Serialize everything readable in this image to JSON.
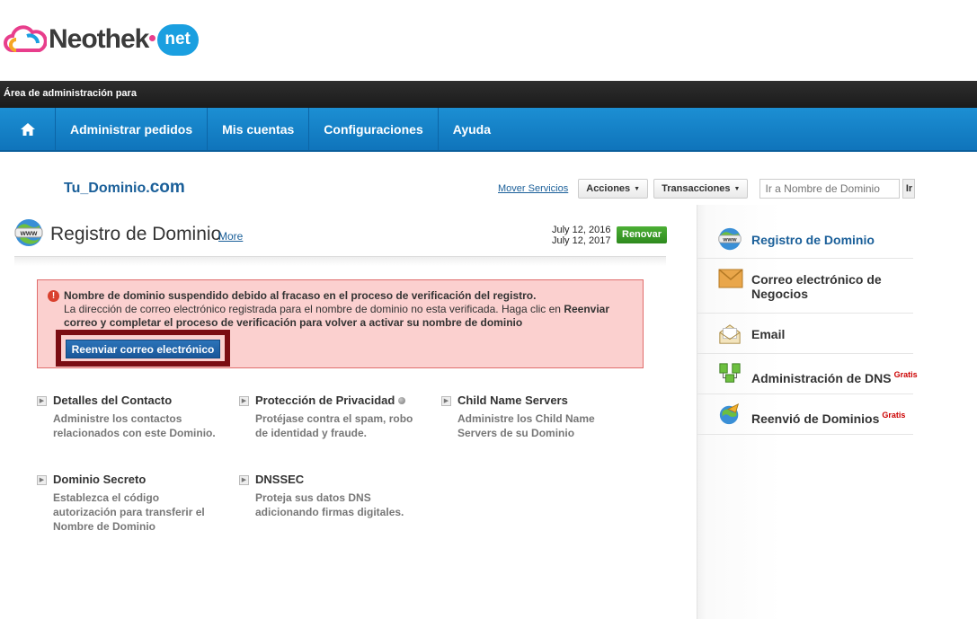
{
  "logo": {
    "name": "Neothek",
    "suffix": "net"
  },
  "admin_bar": {
    "text": "Área de administración para"
  },
  "nav": {
    "items": [
      {
        "label": "Administrar pedidos"
      },
      {
        "label": "Mis cuentas"
      },
      {
        "label": "Configuraciones"
      },
      {
        "label": "Ayuda"
      }
    ]
  },
  "domain": {
    "name": "Tu_Dominio.",
    "tld": "com"
  },
  "tools": {
    "move_services": "Mover Servicios",
    "actions": "Acciones",
    "transactions": "Transacciones",
    "goto_placeholder": "Ir a Nombre de Dominio",
    "go_label": "Ir"
  },
  "panel": {
    "title": "Registro de Dominio",
    "more": "More",
    "date_start": "July 12, 2016",
    "date_end": "July 12, 2017",
    "renew": "Renovar"
  },
  "alert": {
    "headline": "Nombre de dominio suspendido debido al fracaso en el proceso de verificación del registro.",
    "body_pre": "La dirección de correo electrónico registrada para el nombre de dominio no esta verificada. Haga clic en ",
    "body_bold": "Reenviar correo y completar el proceso de verificación para volver a activar su nombre de dominio",
    "button": "Reenviar correo electrónico"
  },
  "features": [
    {
      "title": "Detalles del Contacto",
      "desc": "Administre los contactos relacionados con este Dominio."
    },
    {
      "title": "Protección de Privacidad",
      "desc": "Protéjase contra el spam, robo de identidad y fraude."
    },
    {
      "title": "Child Name Servers",
      "desc": "Administre los Child Name Servers de su Dominio"
    },
    {
      "title": "Dominio Secreto",
      "desc": "Establezca el código autorización para transferir el Nombre de Dominio"
    },
    {
      "title": "DNSSEC",
      "desc": "Proteja sus datos DNS adicionando firmas digitales."
    }
  ],
  "sidebar": {
    "items": [
      {
        "label": "Registro de Dominio",
        "icon": "www-globe-icon"
      },
      {
        "label": "Correo electrónico de Negocios",
        "icon": "envelope-icon"
      },
      {
        "label": "Email",
        "icon": "open-envelope-icon"
      },
      {
        "label": "Administración de DNS",
        "badge": "Gratis",
        "icon": "dns-servers-icon"
      },
      {
        "label": "Reenvió de Dominios",
        "badge": "Gratis",
        "icon": "forward-globe-icon"
      }
    ]
  }
}
